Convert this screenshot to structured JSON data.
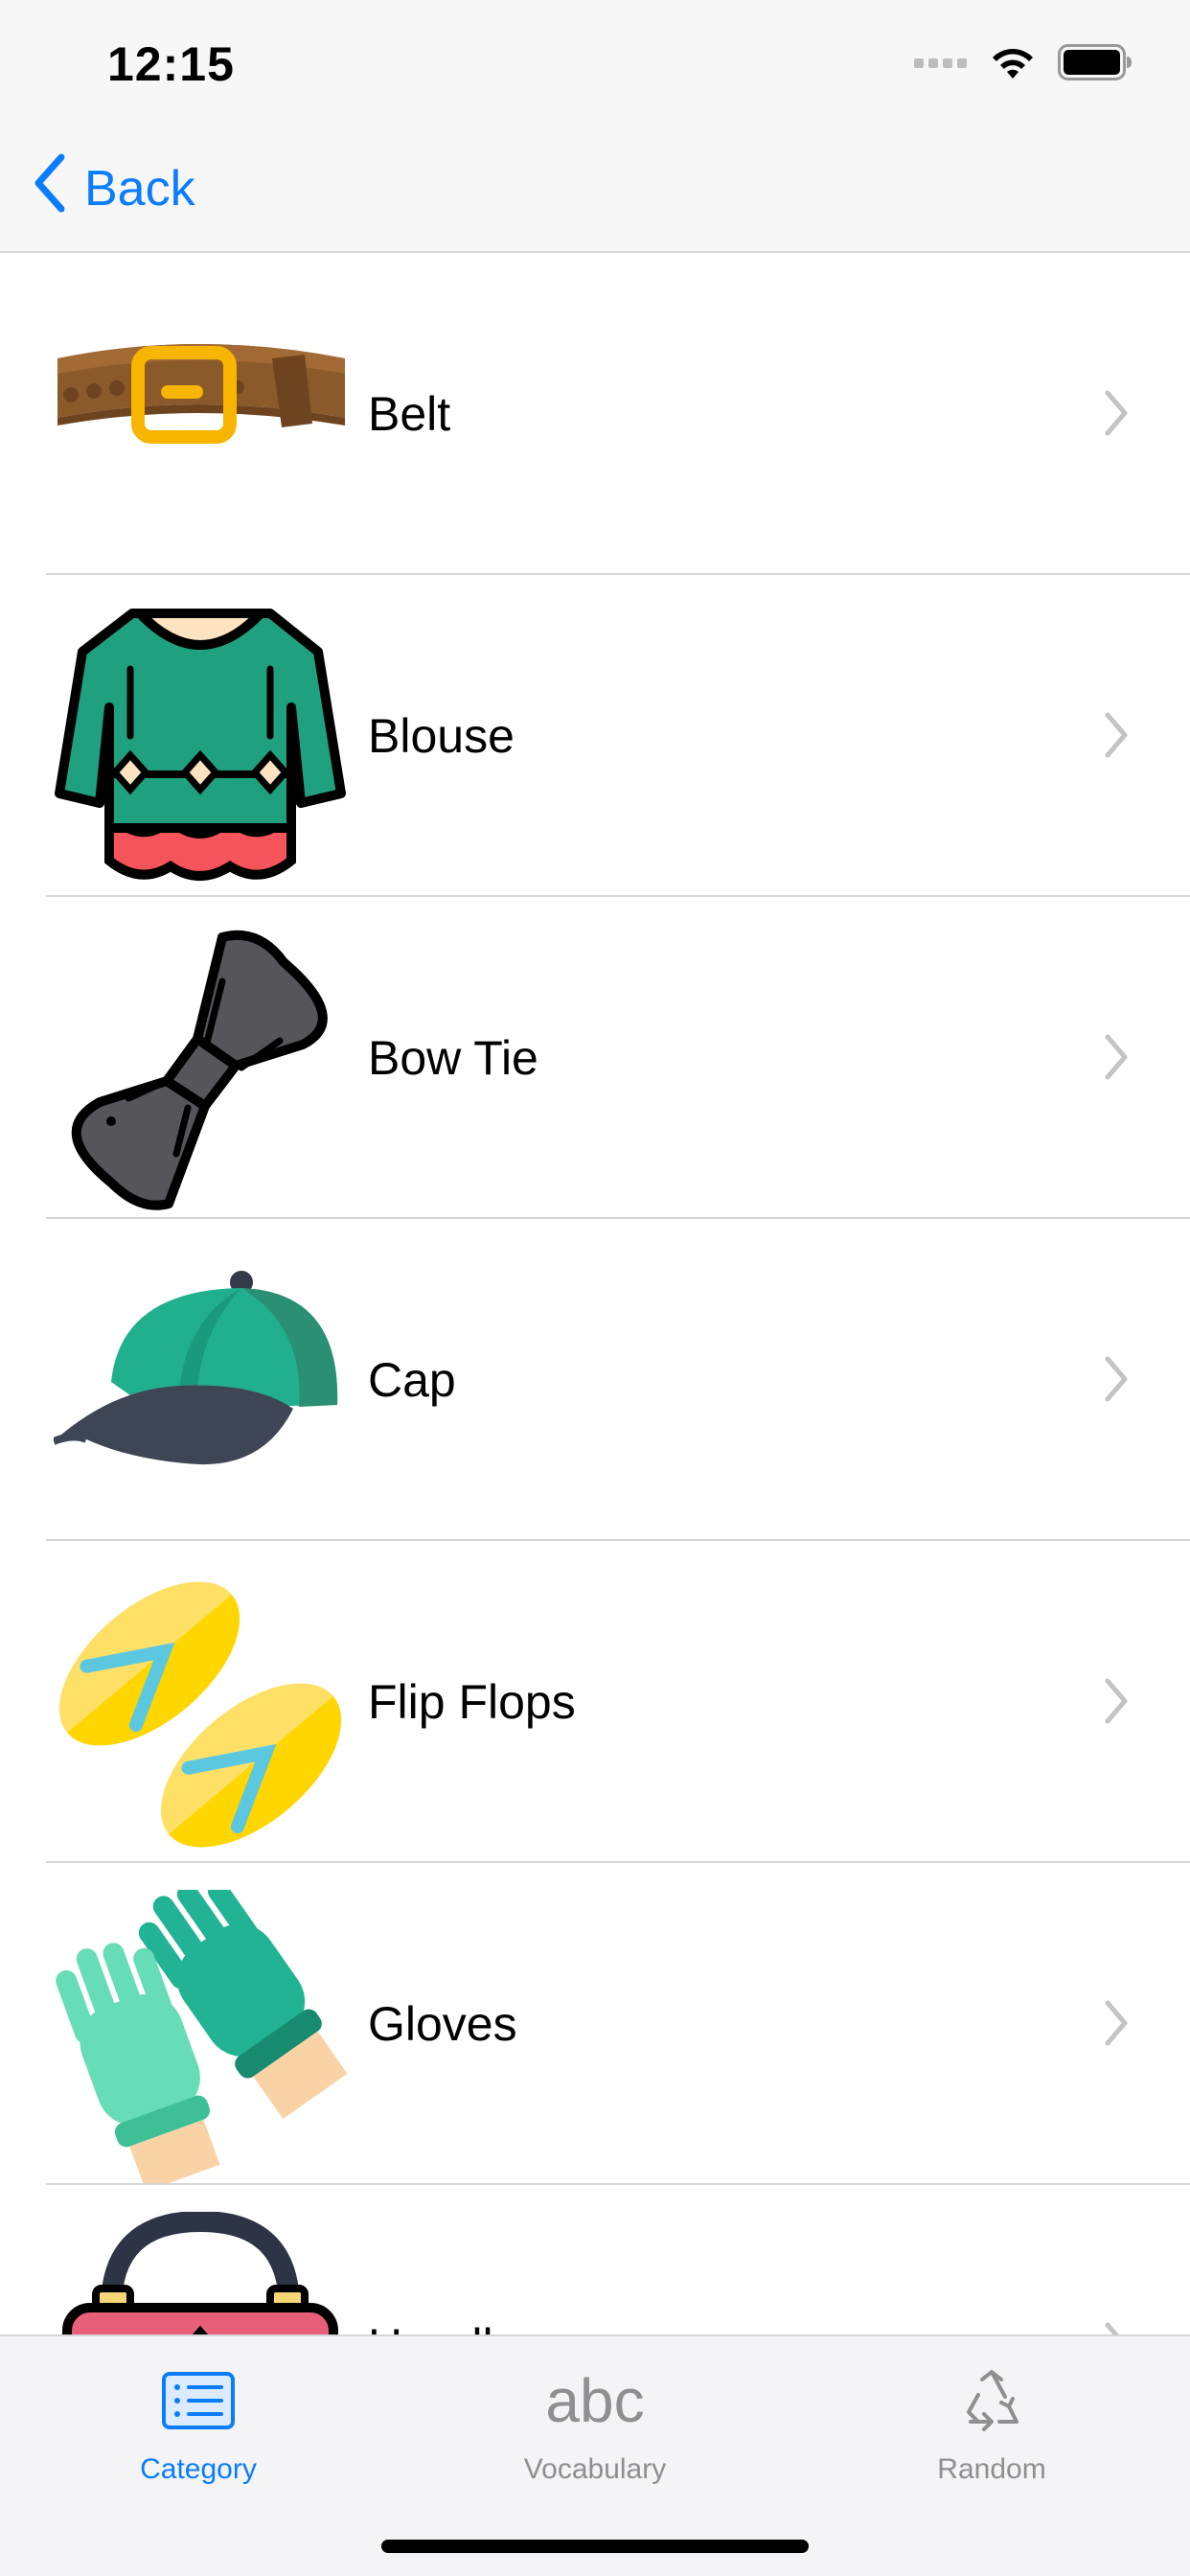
{
  "status_bar": {
    "time": "12:15",
    "icons": [
      "signal-icon",
      "wifi-icon",
      "battery-icon"
    ]
  },
  "nav": {
    "back_label": "Back",
    "accent_color": "#0a7cff"
  },
  "items": [
    {
      "label": "Belt",
      "icon": "belt-icon"
    },
    {
      "label": "Blouse",
      "icon": "blouse-icon"
    },
    {
      "label": "Bow Tie",
      "icon": "bow-tie-icon"
    },
    {
      "label": "Cap",
      "icon": "cap-icon"
    },
    {
      "label": "Flip Flops",
      "icon": "flip-flops-icon"
    },
    {
      "label": "Gloves",
      "icon": "gloves-icon"
    },
    {
      "label": "Handbag",
      "icon": "handbag-icon"
    }
  ],
  "tab_bar": {
    "tabs": [
      {
        "label": "Category",
        "icon": "category-list-icon",
        "active": true
      },
      {
        "label": "Vocabulary",
        "icon": "abc-icon",
        "icon_text": "abc",
        "active": false
      },
      {
        "label": "Random",
        "icon": "recycle-icon",
        "active": false
      }
    ]
  }
}
